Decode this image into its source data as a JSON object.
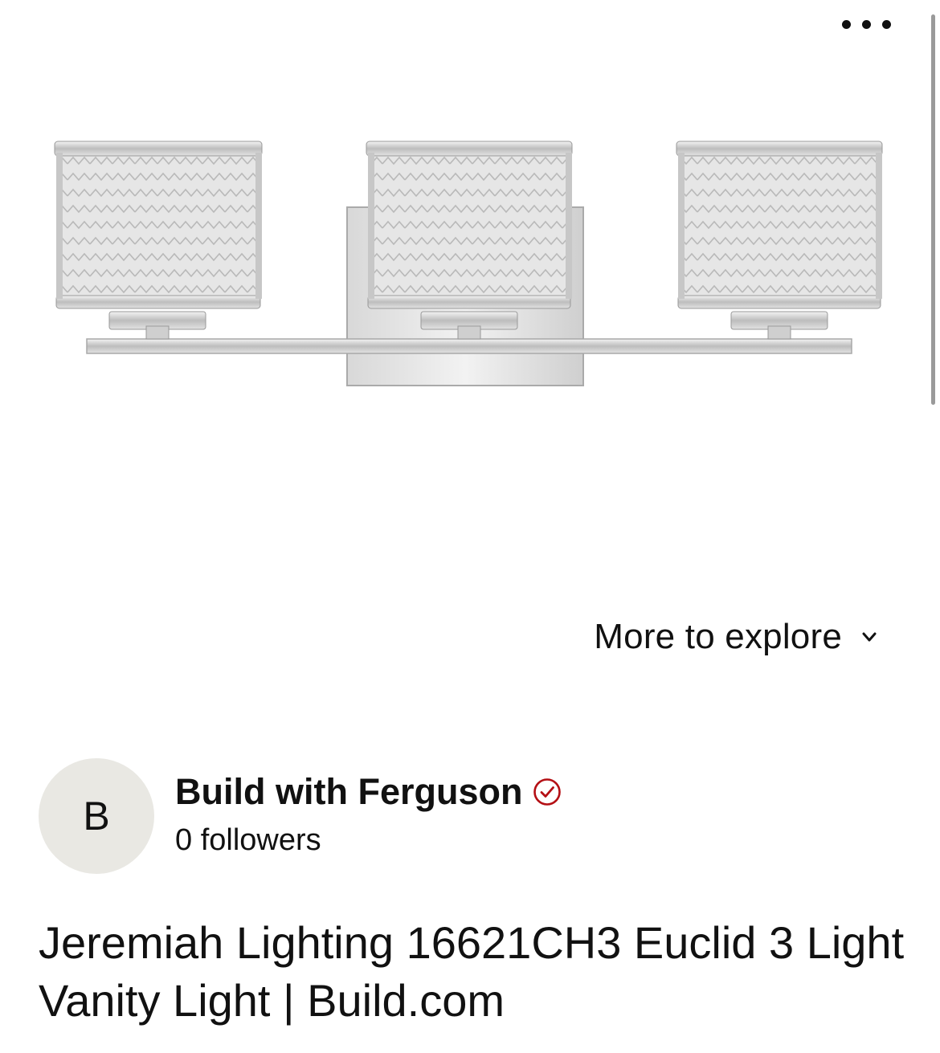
{
  "header": {
    "more_menu_icon": "more-options-icon"
  },
  "product_image": {
    "description_icon": "vanity-light-image"
  },
  "explore": {
    "label": "More to explore",
    "icon": "chevron-down-icon"
  },
  "creator": {
    "avatar_letter": "B",
    "name": "Build with Ferguson",
    "verified_icon": "verified-check-icon",
    "verified_color": "#b40f14",
    "followers": "0 followers"
  },
  "pin": {
    "title": "Jeremiah Lighting 16621CH3 Euclid 3 Light Vanity Light | Build.com"
  }
}
